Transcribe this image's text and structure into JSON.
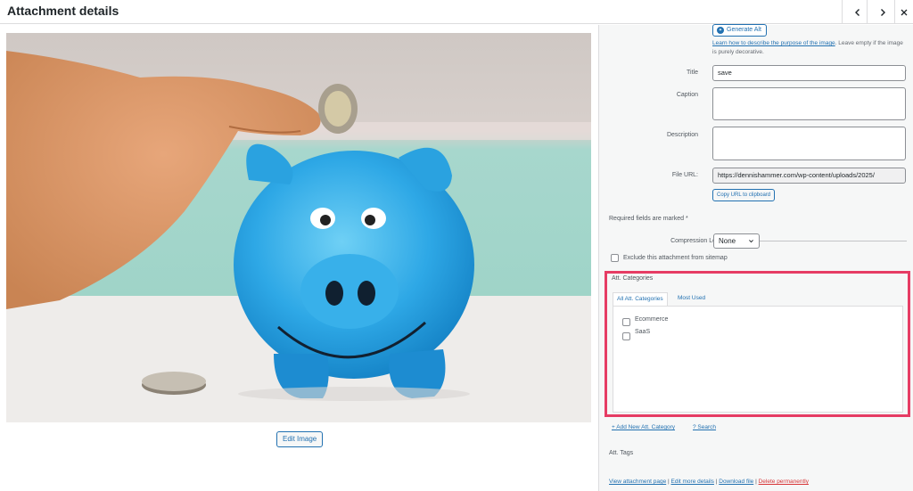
{
  "header": {
    "title": "Attachment details",
    "prev_icon": "chevron-left-icon",
    "next_icon": "chevron-right-icon",
    "close_icon": "close-icon"
  },
  "media": {
    "image_alt": "Hand placing coin into blue piggy bank",
    "edit_label": "Edit Image"
  },
  "sidebar": {
    "generate_alt_label": "Generate Alt",
    "alt_help_link": "Learn how to describe the purpose of the image",
    "alt_help_rest": ". Leave empty if the image is purely decorative.",
    "title_label": "Title",
    "title_value": "save",
    "caption_label": "Caption",
    "caption_value": "",
    "description_label": "Description",
    "description_value": "",
    "file_url_label": "File URL:",
    "file_url_value": "https://dennishammer.com/wp-content/uploads/2025/",
    "copy_url_label": "Copy URL to clipboard",
    "required_note": "Required fields are marked *",
    "compression_label": "Compression Level",
    "compression_value": "None",
    "exclude_label": "Exclude this attachment from sitemap",
    "categories": {
      "title": "Att. Categories",
      "tabs": [
        "All Att. Categories",
        "Most Used"
      ],
      "items": [
        "Ecommerce",
        "SaaS"
      ],
      "highlight_color": "#e63c64"
    },
    "add_new_label": "+ Add New Att. Category",
    "search_label": "? Search",
    "tags_label": "Att. Tags",
    "bottom": {
      "view_page": "View attachment page",
      "edit_more": "Edit more details",
      "download": "Download file",
      "delete": "Delete permanently",
      "sep": " | "
    }
  },
  "colors": {
    "accent": "#2271b1",
    "danger": "#d63638",
    "highlight": "#e63c64"
  }
}
